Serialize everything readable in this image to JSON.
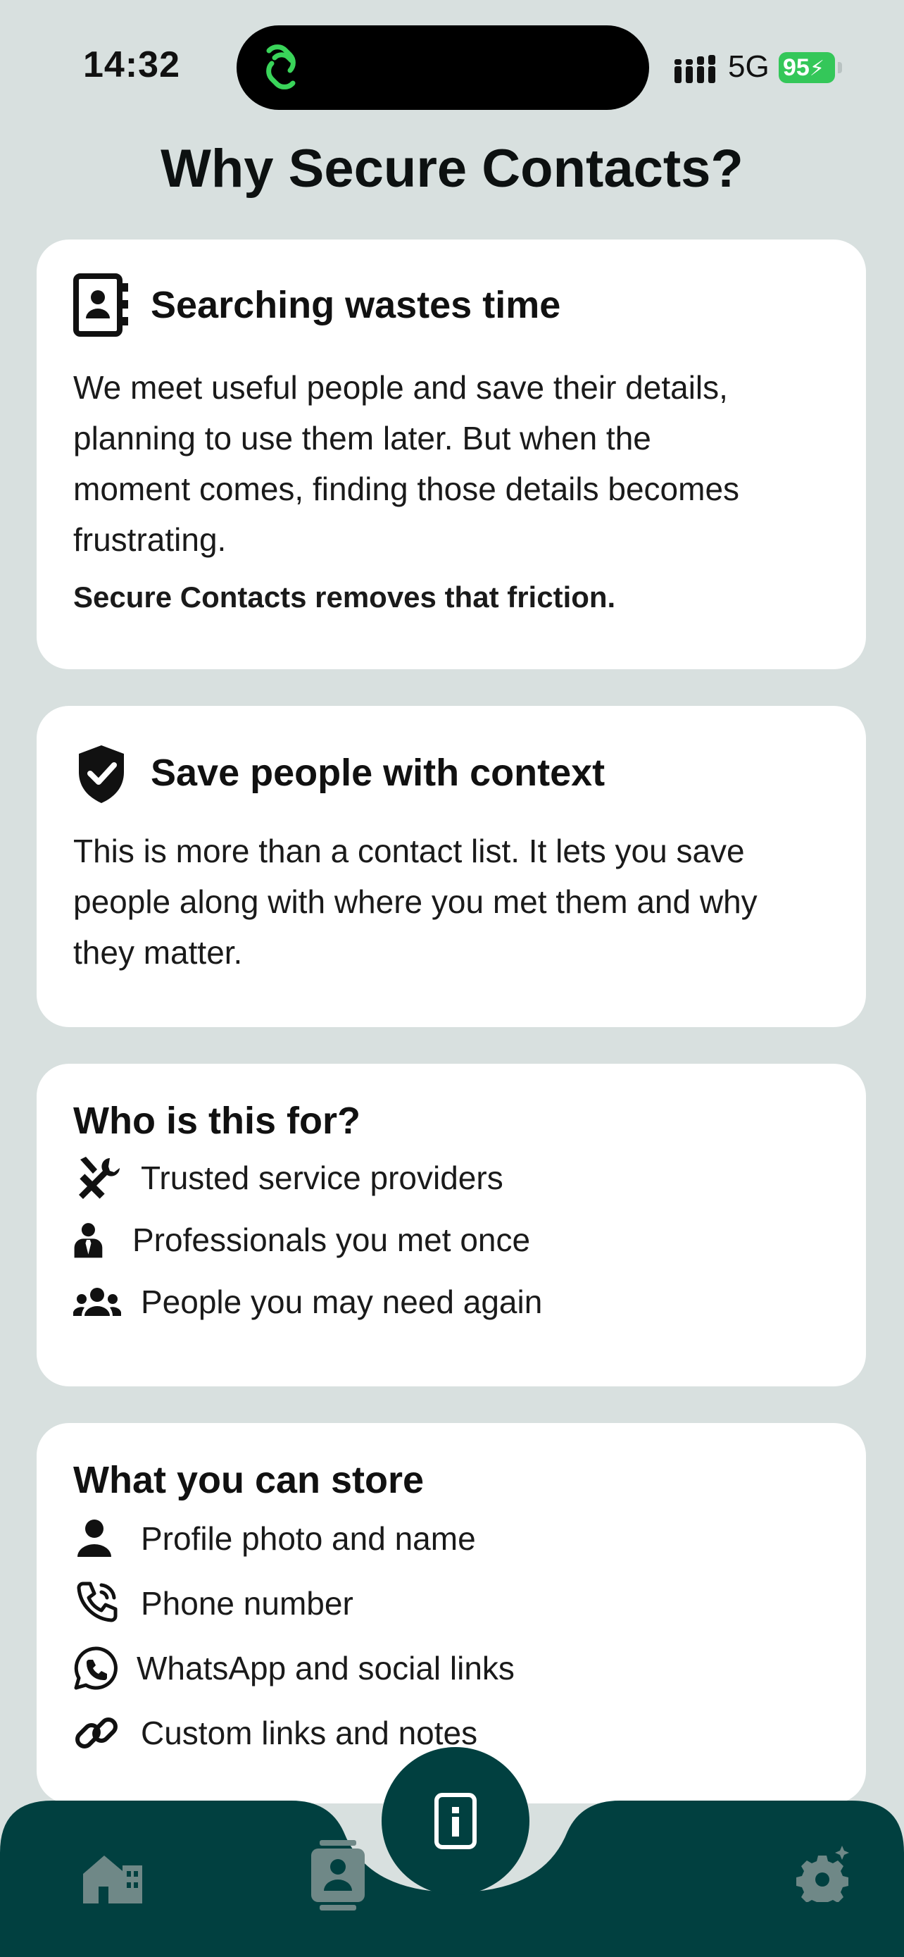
{
  "status": {
    "time": "14:32",
    "network": "5G",
    "battery": "95"
  },
  "page": {
    "title": "Why Secure Contacts?"
  },
  "cards": {
    "searching": {
      "title": "Searching wastes time",
      "body_lines": [
        "We meet useful people and save their details,",
        "planning to use them later. But when the",
        "moment comes, finding those details becomes",
        "frustrating."
      ],
      "emphasis": "Secure Contacts removes that friction."
    },
    "context": {
      "title": "Save people with context",
      "body_lines": [
        "This is more than a contact list. It lets you save",
        "people along with where you met them and why",
        "they matter."
      ]
    },
    "who": {
      "title": "Who is this for?",
      "items": [
        {
          "icon": "tools-icon",
          "label": "Trusted service providers"
        },
        {
          "icon": "professional-icon",
          "label": "Professionals you met once"
        },
        {
          "icon": "group-icon",
          "label": "People you may need again"
        }
      ]
    },
    "store": {
      "title": "What you can store",
      "items": [
        {
          "icon": "person-icon",
          "label": "Profile photo and name"
        },
        {
          "icon": "phone-icon",
          "label": "Phone number"
        },
        {
          "icon": "whatsapp-icon",
          "label": "WhatsApp and social links"
        },
        {
          "icon": "link-icon",
          "label": "Custom links and notes"
        }
      ]
    }
  },
  "nav": {
    "items": [
      "home-icon",
      "contacts-icon",
      "info-card-icon",
      "settings-icon"
    ],
    "active": "info-card-icon"
  },
  "colors": {
    "brand": "#014040",
    "accent_green": "#34c759",
    "background": "#d8e0df"
  }
}
